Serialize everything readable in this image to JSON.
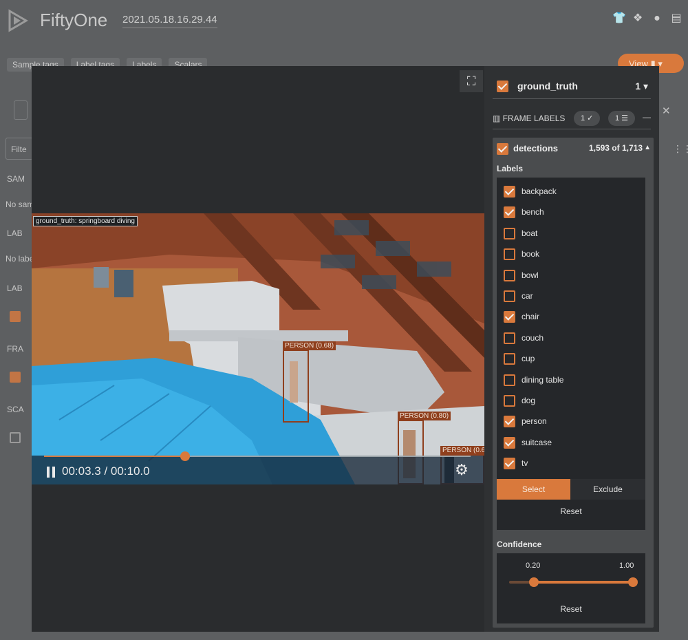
{
  "app": {
    "title": "FiftyOne",
    "dataset_name": "2021.05.18.16.29.44",
    "header_icons": [
      "tshirt-icon",
      "slack-icon",
      "github-icon",
      "book-icon"
    ]
  },
  "background": {
    "tabs": [
      "Sample tags",
      "Label tags",
      "Labels",
      "Scalars"
    ],
    "view_button": "View",
    "filter_placeholder": "Filte",
    "sections": [
      "SAM",
      "LAB",
      "LAB",
      "FRA",
      "SCA"
    ],
    "empty_texts": [
      "No sam",
      "No labe"
    ]
  },
  "viewer": {
    "ground_truth_label": "ground_truth: springboard diving",
    "detections": [
      {
        "label": "PERSON (0.68)"
      },
      {
        "label": "PERSON (0.80)"
      },
      {
        "label": "PERSON (0.6"
      }
    ],
    "time_display": "00:03.3 / 00:10.0",
    "progress": 0.33
  },
  "sidebar": {
    "ground_truth": {
      "name": "ground_truth",
      "count": "1"
    },
    "frame_labels": {
      "title": "FRAME LABELS",
      "pill_check": "1",
      "pill_filter": "1"
    },
    "detections": {
      "name": "detections",
      "count": "1,593 of 1,713",
      "labels_title": "Labels",
      "labels": [
        {
          "name": "backpack",
          "checked": true
        },
        {
          "name": "bench",
          "checked": true
        },
        {
          "name": "boat",
          "checked": false
        },
        {
          "name": "book",
          "checked": false
        },
        {
          "name": "bowl",
          "checked": false
        },
        {
          "name": "car",
          "checked": false
        },
        {
          "name": "chair",
          "checked": true
        },
        {
          "name": "couch",
          "checked": false
        },
        {
          "name": "cup",
          "checked": false
        },
        {
          "name": "dining table",
          "checked": false
        },
        {
          "name": "dog",
          "checked": false
        },
        {
          "name": "person",
          "checked": true
        },
        {
          "name": "suitcase",
          "checked": true
        },
        {
          "name": "tv",
          "checked": true
        }
      ],
      "select_label": "Select",
      "exclude_label": "Exclude",
      "reset_label": "Reset",
      "confidence": {
        "title": "Confidence",
        "min": "0.20",
        "max": "1.00",
        "low": 0.2,
        "high": 1.0,
        "reset_label": "Reset"
      }
    }
  },
  "colors": {
    "accent": "#d9793c",
    "detection_box": "#8f3f1d",
    "panel": "#25272a"
  }
}
